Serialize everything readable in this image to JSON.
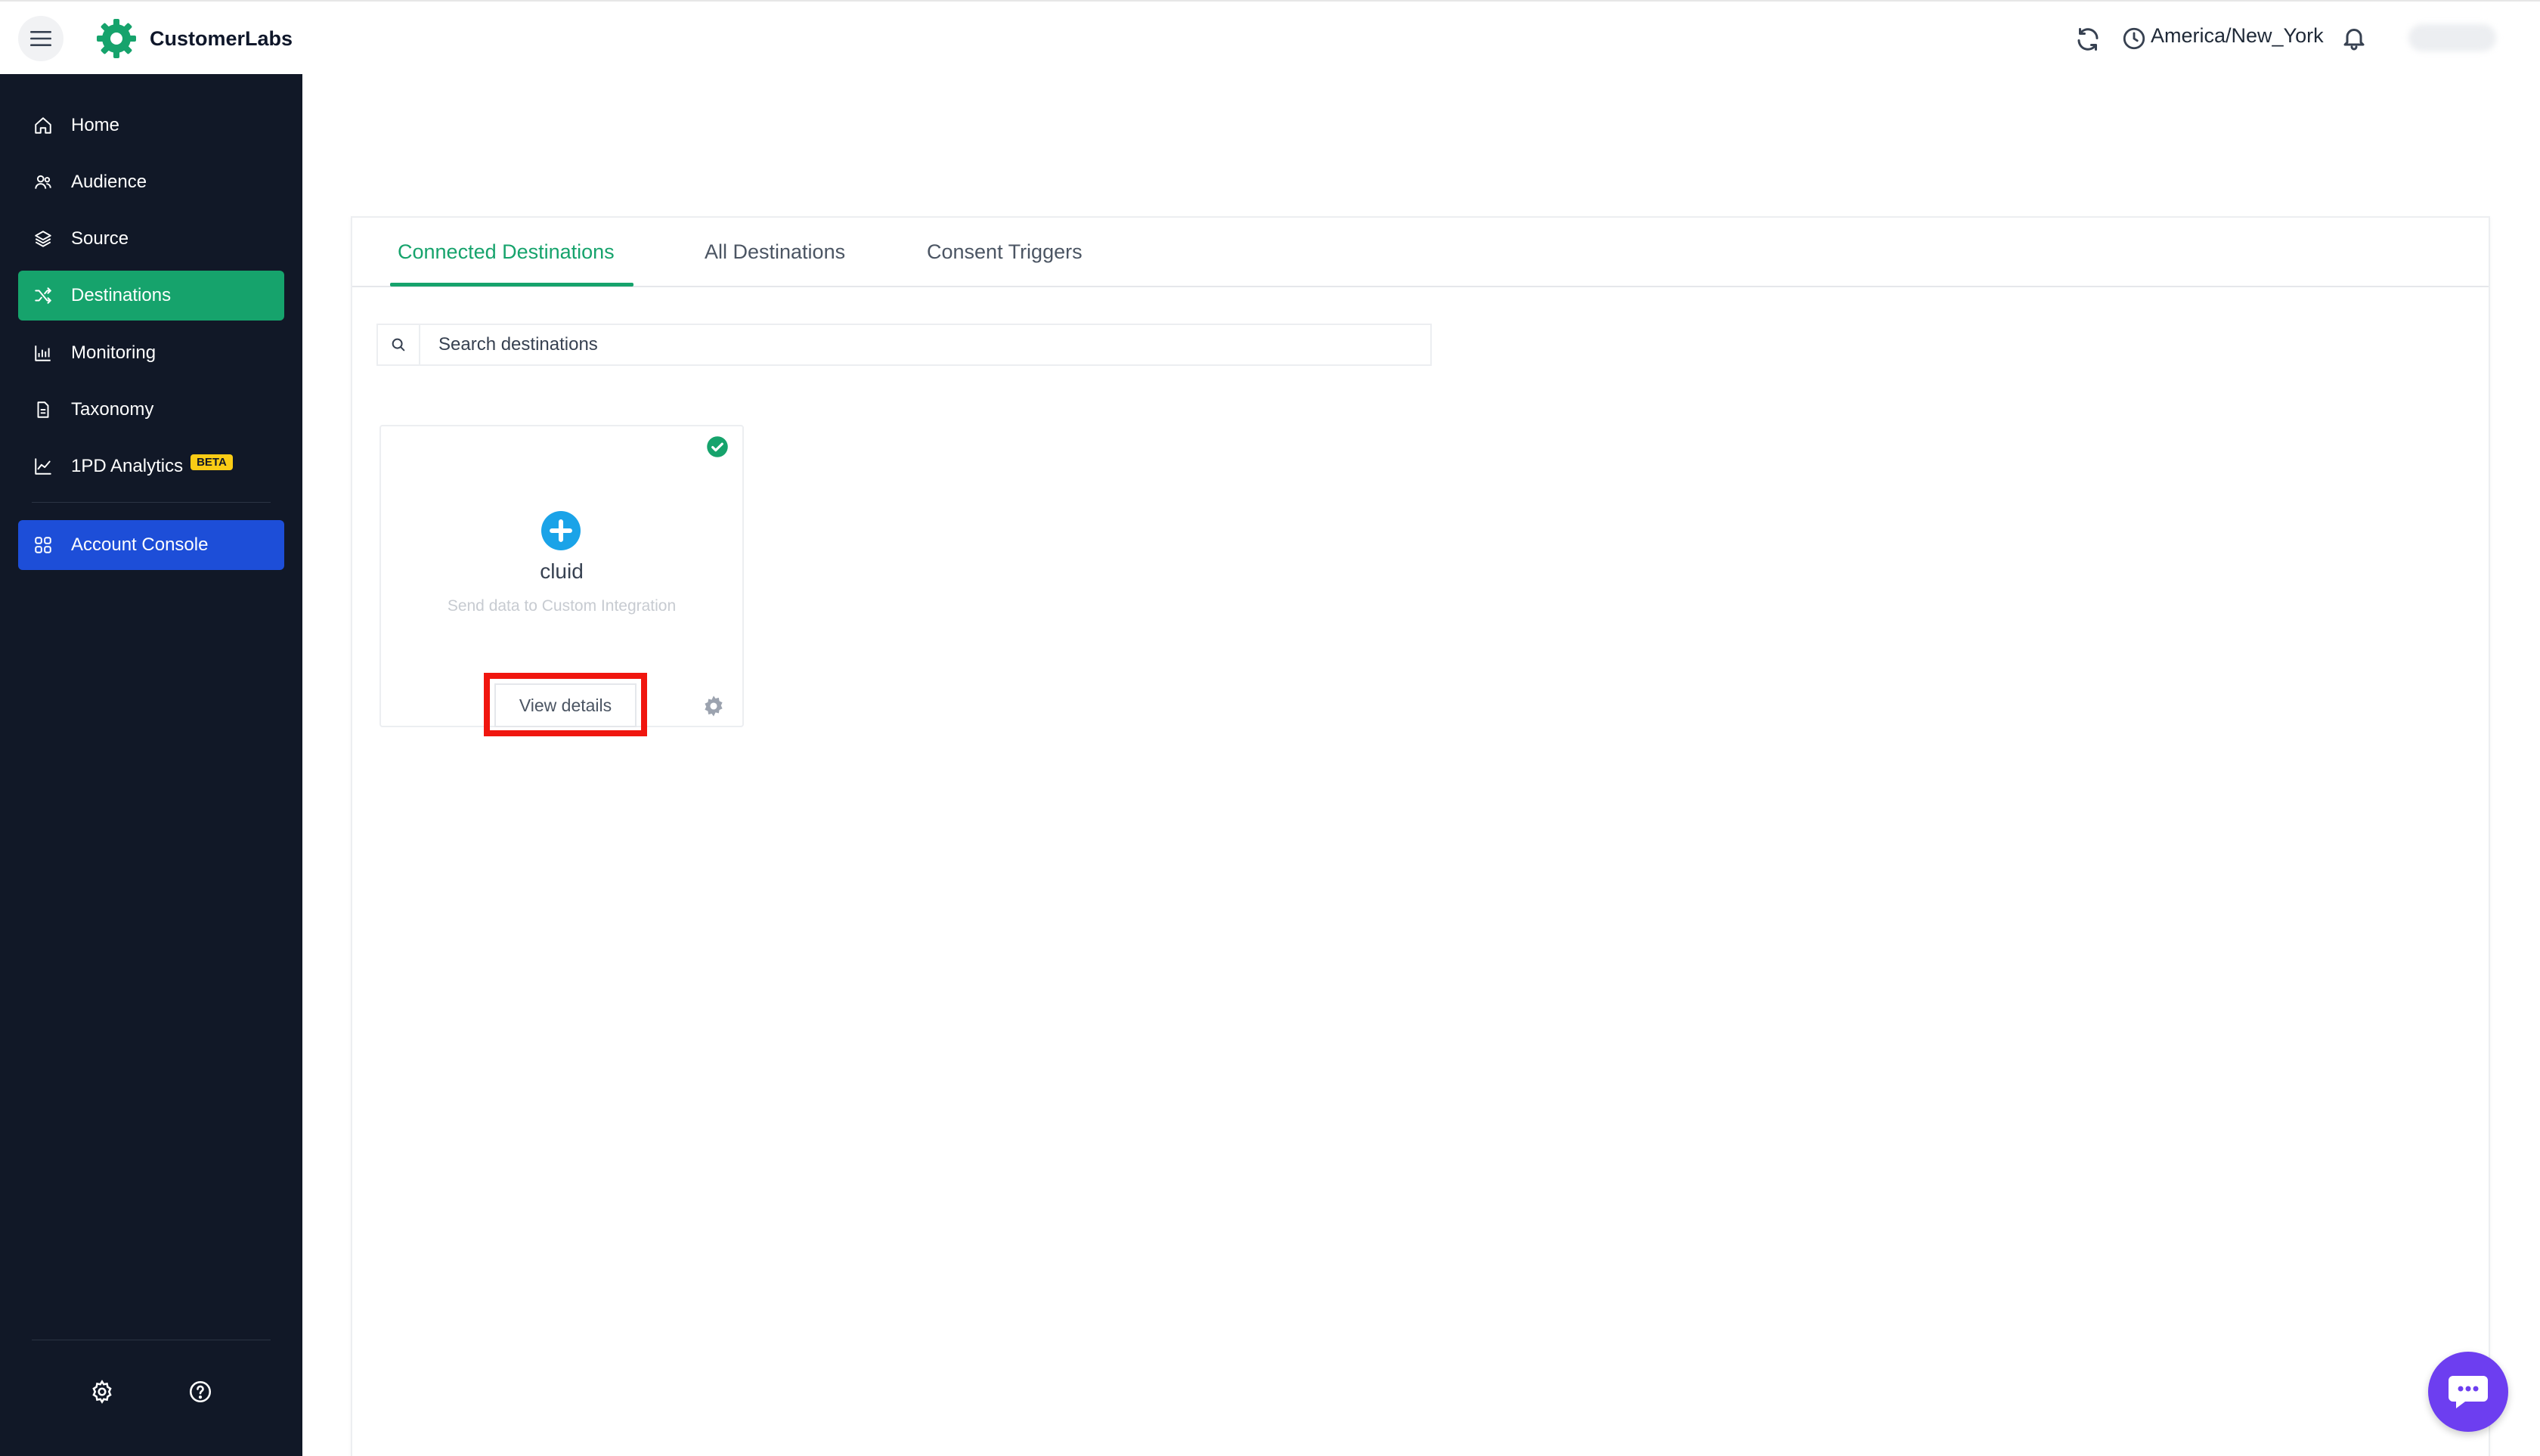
{
  "app": {
    "name": "CustomerLabs",
    "brand_color": "#16a36c"
  },
  "header": {
    "timezone": "America/New_York",
    "icons": [
      "menu-icon",
      "refresh-icon",
      "clock-icon",
      "bell-icon"
    ]
  },
  "sidebar": {
    "items": [
      {
        "label": "Home",
        "icon": "home-icon"
      },
      {
        "label": "Audience",
        "icon": "users-icon"
      },
      {
        "label": "Source",
        "icon": "layers-icon"
      },
      {
        "label": "Destinations",
        "icon": "shuffle-icon",
        "active": true
      },
      {
        "label": "Monitoring",
        "icon": "chart-icon"
      },
      {
        "label": "Taxonomy",
        "icon": "document-icon"
      },
      {
        "label": "1PD Analytics",
        "icon": "trend-icon",
        "badge": "BETA"
      }
    ],
    "console": {
      "label": "Account Console",
      "icon": "grid-icon"
    },
    "bottom_icons": [
      "gear-icon",
      "help-icon"
    ]
  },
  "tabs": [
    {
      "label": "Connected Destinations",
      "active": true
    },
    {
      "label": "All Destinations"
    },
    {
      "label": "Consent Triggers"
    }
  ],
  "search": {
    "placeholder": "Search destinations"
  },
  "destinations": [
    {
      "name": "cluid",
      "description": "Send data to Custom Integration",
      "action": "View details",
      "connected": true
    }
  ]
}
